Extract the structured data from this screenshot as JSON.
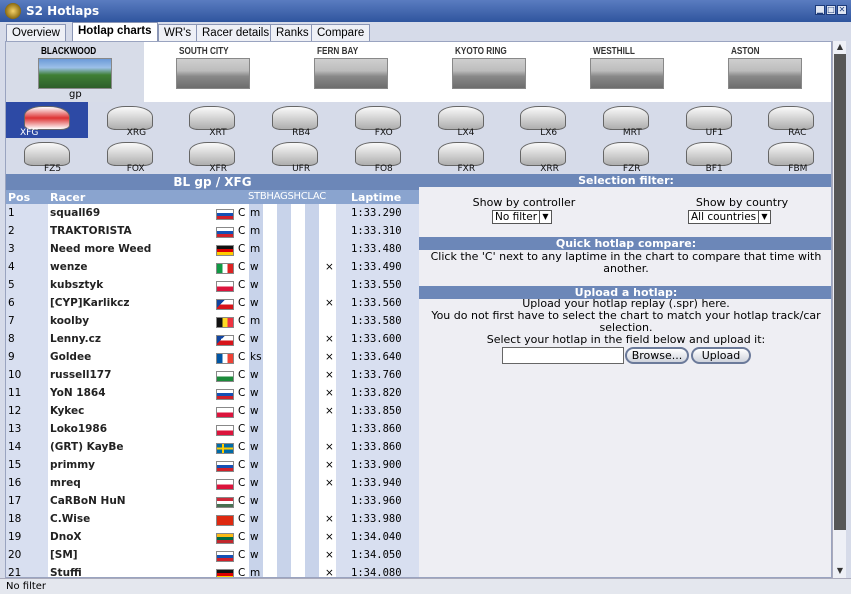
{
  "window": {
    "title": "S2 Hotlaps"
  },
  "tabs": [
    "Overview",
    "Hotlap charts",
    "WR's",
    "Racer details",
    "Ranks",
    "Compare"
  ],
  "tracks": [
    {
      "name": "BLACKWOOD",
      "config": "gp",
      "active": true
    },
    {
      "name": "SOUTH CITY",
      "config": "",
      "active": false
    },
    {
      "name": "FERN BAY",
      "config": "",
      "active": false
    },
    {
      "name": "KYOTO RING",
      "config": "",
      "active": false
    },
    {
      "name": "WESTHILL",
      "config": "",
      "active": false
    },
    {
      "name": "ASTON",
      "config": "",
      "active": false
    }
  ],
  "cars": [
    "XFG",
    "XRG",
    "XRT",
    "RB4",
    "FXO",
    "LX4",
    "LX6",
    "MRT",
    "UF1",
    "RAC",
    "FZ5",
    "FOX",
    "XFR",
    "UFR",
    "FO8",
    "FXR",
    "XRR",
    "FZR",
    "BF1",
    "FBM"
  ],
  "chart": {
    "title": "BL gp / XFG",
    "columns": {
      "pos": "Pos",
      "racer": "Racer",
      "flags": "STBHAGSHCLAC",
      "laptime": "Laptime"
    },
    "rows": [
      {
        "pos": "1",
        "racer": "squall69",
        "country": "si",
        "ctrl": "C",
        "input": "m",
        "clac": "",
        "laptime": "1:33.290"
      },
      {
        "pos": "2",
        "racer": "TRAKTORISTA",
        "country": "si",
        "ctrl": "C",
        "input": "m",
        "clac": "",
        "laptime": "1:33.310"
      },
      {
        "pos": "3",
        "racer": "Need more Weed",
        "country": "de",
        "ctrl": "C",
        "input": "m",
        "clac": "",
        "laptime": "1:33.480"
      },
      {
        "pos": "4",
        "racer": "wenze",
        "country": "it",
        "ctrl": "C",
        "input": "w",
        "clac": "×",
        "laptime": "1:33.490"
      },
      {
        "pos": "5",
        "racer": "kubsztyk",
        "country": "pl",
        "ctrl": "C",
        "input": "w",
        "clac": "",
        "laptime": "1:33.550"
      },
      {
        "pos": "6",
        "racer": "[CYP]Karlikcz",
        "country": "cz",
        "ctrl": "C",
        "input": "w",
        "clac": "×",
        "laptime": "1:33.560"
      },
      {
        "pos": "7",
        "racer": "koolby",
        "country": "be",
        "ctrl": "C",
        "input": "m",
        "clac": "",
        "laptime": "1:33.580"
      },
      {
        "pos": "8",
        "racer": "Lenny.cz",
        "country": "cz",
        "ctrl": "C",
        "input": "w",
        "clac": "×",
        "laptime": "1:33.600"
      },
      {
        "pos": "9",
        "racer": "Goldee",
        "country": "fr",
        "ctrl": "C",
        "input": "ks",
        "clac": "×",
        "laptime": "1:33.640"
      },
      {
        "pos": "10",
        "racer": "russell177",
        "country": "wa",
        "ctrl": "C",
        "input": "w",
        "clac": "×",
        "laptime": "1:33.760"
      },
      {
        "pos": "11",
        "racer": "YoN 1864",
        "country": "si",
        "ctrl": "C",
        "input": "w",
        "clac": "×",
        "laptime": "1:33.820"
      },
      {
        "pos": "12",
        "racer": "Kykec",
        "country": "pl",
        "ctrl": "C",
        "input": "w",
        "clac": "×",
        "laptime": "1:33.850"
      },
      {
        "pos": "13",
        "racer": "Loko1986",
        "country": "pl",
        "ctrl": "C",
        "input": "w",
        "clac": "",
        "laptime": "1:33.860"
      },
      {
        "pos": "14",
        "racer": "(GRT) KayBe",
        "country": "se",
        "ctrl": "C",
        "input": "w",
        "clac": "×",
        "laptime": "1:33.860"
      },
      {
        "pos": "15",
        "racer": "primmy",
        "country": "si",
        "ctrl": "C",
        "input": "w",
        "clac": "×",
        "laptime": "1:33.900"
      },
      {
        "pos": "16",
        "racer": "mreq",
        "country": "pl",
        "ctrl": "C",
        "input": "w",
        "clac": "×",
        "laptime": "1:33.940"
      },
      {
        "pos": "17",
        "racer": "CaRBoN HuN",
        "country": "hu",
        "ctrl": "C",
        "input": "w",
        "clac": "",
        "laptime": "1:33.960"
      },
      {
        "pos": "18",
        "racer": "C.Wise",
        "country": "cn",
        "ctrl": "C",
        "input": "w",
        "clac": "×",
        "laptime": "1:33.980"
      },
      {
        "pos": "19",
        "racer": "DnoX",
        "country": "lt",
        "ctrl": "C",
        "input": "w",
        "clac": "×",
        "laptime": "1:34.040"
      },
      {
        "pos": "20",
        "racer": "[SM]",
        "country": "si",
        "ctrl": "C",
        "input": "w",
        "clac": "×",
        "laptime": "1:34.050"
      },
      {
        "pos": "21",
        "racer": "Stuffi",
        "country": "de",
        "ctrl": "C",
        "input": "m",
        "clac": "×",
        "laptime": "1:34.080"
      }
    ]
  },
  "selection_filter": {
    "header": "Selection filter:",
    "controller_label": "Show by controller",
    "controller_value": "No filter",
    "country_label": "Show by country",
    "country_value": "All countries"
  },
  "quick_compare": {
    "header": "Quick hotlap compare:",
    "text_line1": "Click the 'C' next to any laptime in the chart to compare that time with",
    "text_line2": "another."
  },
  "upload": {
    "header": "Upload a hotlap:",
    "line1": "Upload your hotlap replay (.spr) here.",
    "line2": "You do not first have to select the chart to match your hotlap track/car",
    "line3": "selection.",
    "line4": "Select your hotlap in the field below and upload it:",
    "browse_label": "Browse...",
    "upload_label": "Upload"
  },
  "status": {
    "text": "No filter"
  },
  "colors": {
    "header_bg": "#6c87b8",
    "subheader_bg": "#8aa4cf",
    "active_car_bg": "#2d4aa5",
    "title_bar": "#2f559e"
  }
}
